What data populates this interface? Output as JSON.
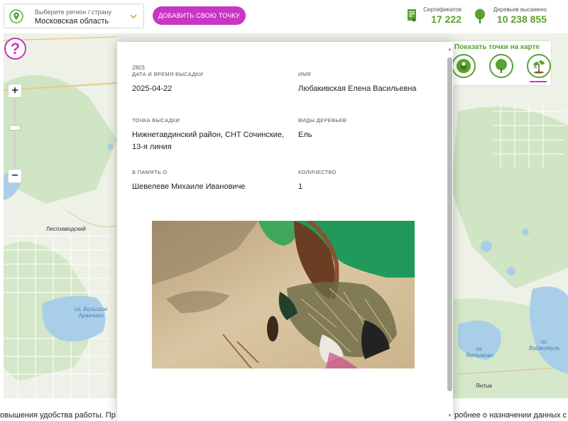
{
  "header": {
    "region_label": "Выберите регион / страну",
    "region_value": "Московская область",
    "add_button": "ДОБАВИТЬ СВОЮ ТОЧКУ",
    "certificates_label": "Сертификатов",
    "certificates_value": "17 222",
    "trees_label": "Деревьев высажено",
    "trees_value": "10 238 855"
  },
  "map": {
    "town_labels": [
      "Лесозаводский",
      "Янтык"
    ],
    "lakes": [
      {
        "label_line1": "оз. Большое",
        "label_line2": "Аракчино"
      },
      {
        "label_line1": "оз.",
        "label_line2": "Янтыково"
      },
      {
        "label_line1": "оз.",
        "label_line2": "Вайволкуль"
      }
    ],
    "help_label": "?",
    "zoom_in_label": "+",
    "zoom_out_label": "−"
  },
  "show_points": {
    "title": "Показать точки на карте",
    "buttons": [
      "memorial-tree-icon",
      "tree-icon",
      "planting-icon"
    ]
  },
  "record": {
    "id": "2803",
    "date_label": "ДАТА И ВРЕМЯ ВЫСАДКИ",
    "date_value": "2025-04-22",
    "name_label": "ИМЯ",
    "name_value": "Любакивская Елена Васильевна",
    "point_label": "ТОЧКА ВЫСАДКИ",
    "point_value": "Нижнетавдинский район, СНТ Сочинские, 13-я линия",
    "species_label": "ВИДЫ ДЕРЕВЬЕВ",
    "species_value": "Ель",
    "memory_label": "В ПАМЯТЬ О",
    "memory_value": "Шевелеве Михаиле Ивановиче",
    "quantity_label": "КОЛИЧЕСТВО",
    "quantity_value": "1"
  },
  "footer": {
    "left_text": "овышения удобства работы. Пр",
    "right_text": "робнее о назначении данных с"
  },
  "colors": {
    "accent_magenta": "#c936c3",
    "accent_green": "#5aa12f",
    "water": "#a9cfe8",
    "map_bg": "#eef1e7"
  }
}
